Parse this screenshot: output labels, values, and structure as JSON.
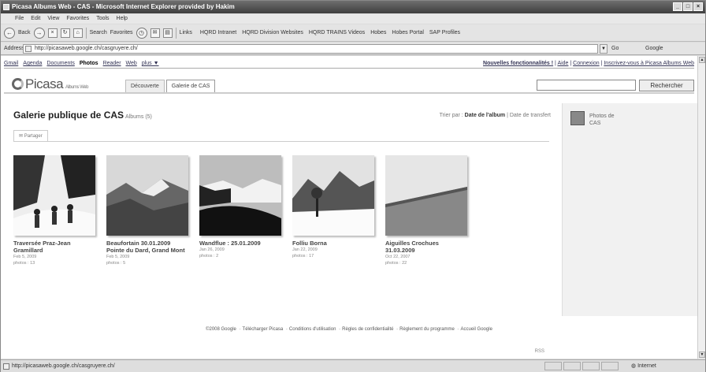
{
  "window": {
    "title": "Picasa Albums Web - CAS - Microsoft Internet Explorer provided by Hakim",
    "controls": [
      "_",
      "□",
      "×"
    ]
  },
  "menu": [
    "File",
    "Edit",
    "View",
    "Favorites",
    "Tools",
    "Help"
  ],
  "toolbar": {
    "back": "Back",
    "search": "Search",
    "favorites": "Favorites",
    "links_label": "Links",
    "links": [
      "HQRD Intranet",
      "HQRD Division Websites",
      "HQRD TRAINS Videos",
      "Hobes",
      "Hobes Portal",
      "SAP Profiles"
    ]
  },
  "address": {
    "label": "Address",
    "url": "http://picasaweb.google.ch/casgruyere.ch/",
    "go": "Go",
    "google": "Google"
  },
  "google_bar": {
    "links": [
      "Gmail",
      "Agenda",
      "Documents",
      "Photos",
      "Reader",
      "Web",
      "plus ▼"
    ],
    "active": "Photos",
    "right_bold": "Nouvelles fonctionnalités !",
    "right_links": [
      "Aide",
      "Connexion",
      "Inscrivez-vous à Picasa Albums Web"
    ]
  },
  "header": {
    "logo": "Picasa",
    "logo_sub": "Albums Web",
    "tabs": [
      "Découverte",
      "Galerie de CAS"
    ],
    "search_placeholder": "",
    "search_button": "Rechercher"
  },
  "gallery": {
    "title": "Galerie publique de CAS",
    "albums_count": "Albums (5)",
    "sort_label": "Trier par :",
    "sort_active": "Date de l'album",
    "sort_other": "Date de transfert",
    "share": "Partager",
    "rss": "RSS",
    "albums": [
      {
        "title": "Traversée Praz-Jean Gramillard",
        "date": "Feb 5, 2009",
        "photos": "photos : 13"
      },
      {
        "title": "Beaufortain 30.01.2009 Pointe du Dard, Grand Mont",
        "date": "Feb 5, 2009",
        "photos": "photos : 5"
      },
      {
        "title": "Wandflue : 25.01.2009",
        "date": "Jan 26, 2009",
        "photos": "photos : 2"
      },
      {
        "title": "Folliu Borna",
        "date": "Jan 22, 2009",
        "photos": "photos : 17"
      },
      {
        "title": "Aiguilles Crochues 31.03.2009",
        "date": "Oct 22, 2007",
        "photos": "photos : 22"
      }
    ]
  },
  "sidebar": {
    "name": "Photos de CAS"
  },
  "footer": {
    "copyright": "©2008 Google",
    "links": [
      "Télécharger Picasa",
      "Conditions d'utilisation",
      "Règles de confidentialité",
      "Règlement du programme",
      "Accueil Google"
    ]
  },
  "status": {
    "url": "http://picasaweb.google.ch/casgruyere.ch/",
    "zone": "Internet"
  }
}
